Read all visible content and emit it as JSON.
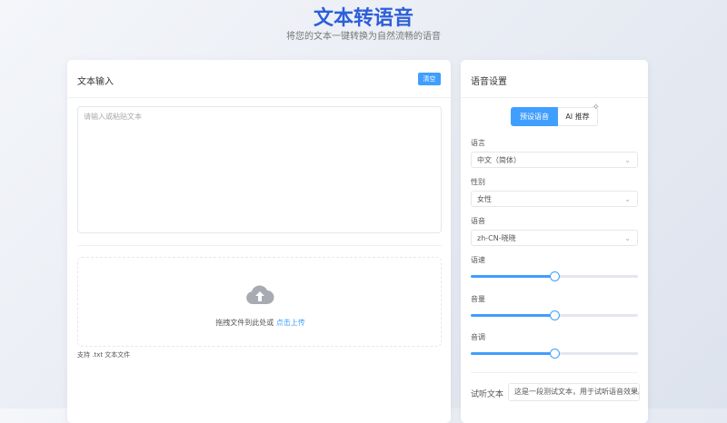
{
  "header": {
    "title": "文本转语音",
    "subtitle": "将您的文本一键转换为自然流畅的语音"
  },
  "input_card": {
    "title": "文本输入",
    "clear_label": "清空",
    "placeholder": "请输入或粘贴文本",
    "upload": {
      "prompt": "拖拽文件到此处或",
      "link": "点击上传",
      "hint": "支持 .txt 文本文件",
      "icon": "cloud-upload-icon"
    }
  },
  "settings": {
    "title": "语音设置",
    "tabs": [
      {
        "label": "预设语音",
        "active": true
      },
      {
        "label": "AI 推荐",
        "active": false,
        "icon": "sparkle-icon"
      }
    ],
    "language": {
      "label": "语言",
      "value": "中文（简体）"
    },
    "gender": {
      "label": "性别",
      "value": "女性"
    },
    "voice": {
      "label": "语音",
      "value": "zh-CN-晓晓"
    },
    "sliders": [
      {
        "label": "语速",
        "value": 0.5
      },
      {
        "label": "音量",
        "value": 0.5
      },
      {
        "label": "音调",
        "value": 0.5
      }
    ],
    "preview": {
      "label": "试听文本",
      "value": "这是一段测试文本，用于试听语音效果。"
    }
  },
  "colors": {
    "accent": "#409eff",
    "title": "#2d5fd8"
  }
}
